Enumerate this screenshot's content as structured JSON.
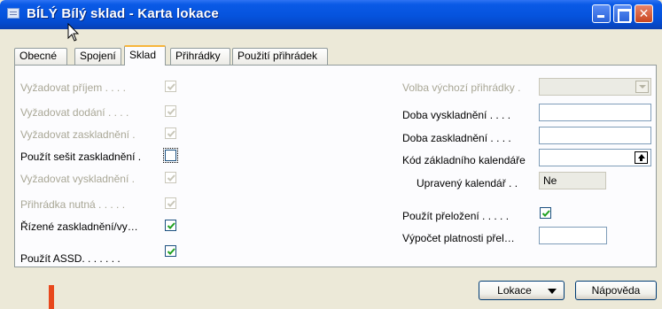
{
  "window": {
    "title": "BÍLÝ Bílý sklad - Karta lokace"
  },
  "tabs": [
    {
      "label": "Obecné"
    },
    {
      "label": "Spojení"
    },
    {
      "label": "Sklad"
    },
    {
      "label": "Přihrádky"
    },
    {
      "label": "Použití přihrádek"
    }
  ],
  "left_fields": [
    {
      "label": "Vyžadovat příjem . . . .",
      "checked": true,
      "enabled": false
    },
    {
      "label": "Vyžadovat dodání . . . .",
      "checked": true,
      "enabled": false
    },
    {
      "label": "Vyžadovat zaskladnění .",
      "checked": true,
      "enabled": false
    },
    {
      "label": "Použít sešit zaskladnění .",
      "checked": false,
      "enabled": true
    },
    {
      "label": "Vyžadovat vyskladnění .",
      "checked": true,
      "enabled": false
    },
    {
      "label": "Přihrádka nutná . . . . .",
      "checked": true,
      "enabled": false
    },
    {
      "label": "Řízené zaskladnění/vy…",
      "checked": true,
      "enabled": true
    },
    {
      "label": "Použít ASSD. . . . . . .",
      "checked": true,
      "enabled": true
    }
  ],
  "right_fields": {
    "default_bin": {
      "label": "Volba výchozí přihrádky .",
      "value": ""
    },
    "outbound_time": {
      "label": "Doba vyskladnění . . . .",
      "value": ""
    },
    "inbound_time": {
      "label": "Doba zaskladnění . . . .",
      "value": ""
    },
    "base_calendar": {
      "label": "Kód základního kalendáře",
      "value": ""
    },
    "custom_calendar": {
      "label": "Upravený kalendář . .",
      "value": "Ne"
    },
    "use_cross_dock": {
      "label": "Použít přeložení . . . . .",
      "checked": true
    },
    "cross_dock_calc": {
      "label": "Výpočet platnosti přel…",
      "value": ""
    }
  },
  "buttons": {
    "location": "Lokace",
    "help": "Nápověda"
  }
}
